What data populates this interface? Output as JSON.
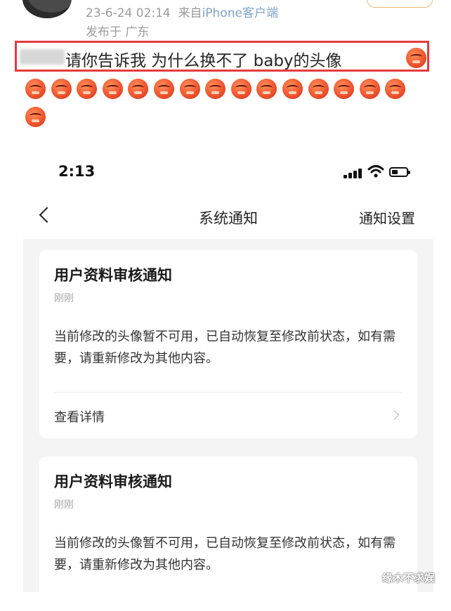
{
  "post": {
    "time": "23-6-24 02:14",
    "source_prefix": "来自",
    "source": "iPhone客户端",
    "location": "发布于 广东",
    "text": "请你告诉我 为什么换不了 baby的头像"
  },
  "phone": {
    "status_time": "2:13",
    "nav_title": "系统通知",
    "nav_settings": "通知设置",
    "cards": [
      {
        "title": "用户资料审核通知",
        "time": "刚刚",
        "body": "当前修改的头像暂不可用，已自动恢复至修改前状态，如有需要，请重新修改为其他内容。",
        "detail": "查看详情"
      },
      {
        "title": "用户资料审核通知",
        "time": "刚刚",
        "body": "当前修改的头像暂不可用，已自动恢复至修改前状态，如有需要，请重新修改为其他内容。"
      }
    ]
  },
  "watermark": "缘木不求娱",
  "colors": {
    "highlight": "#e53b3f",
    "emoji": "#f1552f",
    "meta": "#9b9b9b"
  },
  "icons": [
    "avatar",
    "angry-emoji-icon",
    "back-icon",
    "signal-icon",
    "wifi-icon",
    "battery-icon",
    "chevron-right-icon"
  ]
}
